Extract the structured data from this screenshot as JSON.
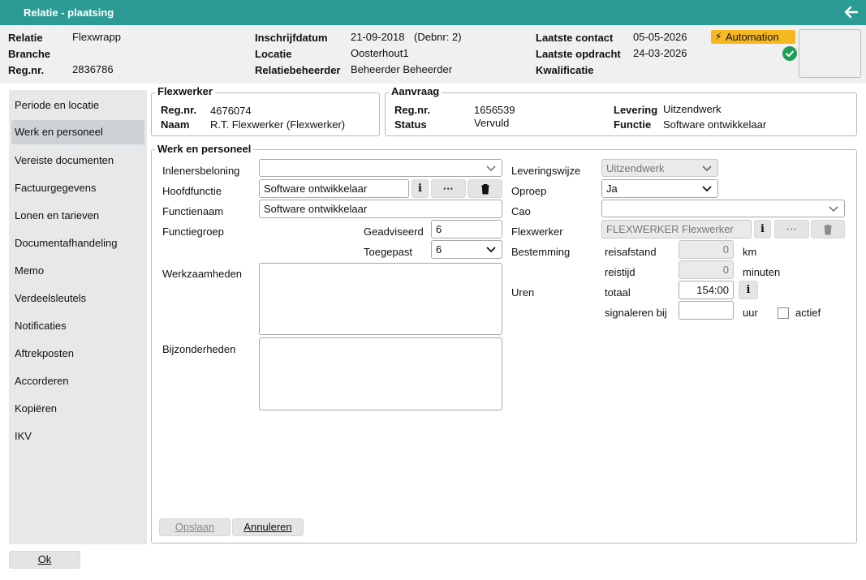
{
  "window": {
    "title": "Relatie - plaatsing"
  },
  "header": {
    "col1": [
      {
        "label": "Relatie",
        "value": "Flexwrapp"
      },
      {
        "label": "Branche",
        "value": ""
      },
      {
        "label": "Reg.nr.",
        "value": "2836786"
      }
    ],
    "inschrijfdatum_label": "Inschrijfdatum",
    "inschrijfdatum": "21-09-2018",
    "debnr": "(Debnr: 2)",
    "locatie_label": "Locatie",
    "locatie": "Oosterhout1",
    "relatiebeheerder_label": "Relatiebeheerder",
    "relatiebeheerder": "Beheerder Beheerder",
    "laatste_contact_label": "Laatste contact",
    "laatste_contact": "05-05-2026",
    "laatste_opdracht_label": "Laatste opdracht",
    "laatste_opdracht": "24-03-2026",
    "kwalificatie_label": "Kwalificatie",
    "badge": "Automation",
    "badge_color": "#f5b820",
    "status_color": "#1f9d55"
  },
  "sidebar": {
    "items": [
      {
        "label": "Periode en locatie"
      },
      {
        "label": "Werk en personeel"
      },
      {
        "label": "Vereiste documenten"
      },
      {
        "label": "Factuurgegevens"
      },
      {
        "label": "Lonen en tarieven"
      },
      {
        "label": "Documentafhandeling"
      },
      {
        "label": "Memo"
      },
      {
        "label": "Verdeelsleutels"
      },
      {
        "label": "Notificaties"
      },
      {
        "label": "Aftrekposten"
      },
      {
        "label": "Accorderen"
      },
      {
        "label": "Kopiëren"
      },
      {
        "label": "IKV"
      }
    ],
    "active_index": 1
  },
  "flexwerker_box": {
    "title": "Flexwerker",
    "regnr_label": "Reg.nr.",
    "regnr": "4676074",
    "naam_label": "Naam",
    "naam": "R.T. Flexwerker (Flexwerker)"
  },
  "aanvraag_box": {
    "title": "Aanvraag",
    "regnr_label": "Reg.nr.",
    "regnr": "1656539",
    "status_label": "Status",
    "status": "Vervuld",
    "levering_label": "Levering",
    "levering": "Uitzendwerk",
    "functie_label": "Functie",
    "functie": "Software ontwikkelaar"
  },
  "werk": {
    "title": "Werk en personeel",
    "inlenersbeloning_label": "Inlenersbeloning",
    "inlenersbeloning": "",
    "hoofdfunctie_label": "Hoofdfunctie",
    "hoofdfunctie": "Software ontwikkelaar",
    "functienaam_label": "Functienaam",
    "functienaam": "Software ontwikkelaar",
    "functiegroep_label": "Functiegroep",
    "geadviseerd_label": "Geadviseerd",
    "geadviseerd": "6",
    "toegepast_label": "Toegepast",
    "toegepast": "6",
    "werkzaamheden_label": "Werkzaamheden",
    "bijzonderheden_label": "Bijzonderheden",
    "leveringswijze_label": "Leveringswijze",
    "leveringswijze": "Uitzendwerk",
    "oproep_label": "Oproep",
    "oproep": "Ja",
    "cao_label": "Cao",
    "cao": "",
    "flexwerker_label": "Flexwerker",
    "flexwerker": "FLEXWERKER Flexwerker",
    "bestemming_label": "Bestemming",
    "reisafstand_label": "reisafstand",
    "reisafstand": "0",
    "km_label": "km",
    "reistijd_label": "reistijd",
    "reistijd": "0",
    "minuten_label": "minuten",
    "uren_label": "Uren",
    "totaal_label": "totaal",
    "totaal": "154:00",
    "signaleren_label": "signaleren bij",
    "signaleren": "",
    "uur_label": "uur",
    "actief_label": "actief",
    "actief": false,
    "opslaan_label": "Opslaan",
    "annuleren_label": "Annuleren",
    "info_glyph": "i",
    "more_glyph": "···"
  },
  "footer": {
    "ok_label": "Ok"
  }
}
